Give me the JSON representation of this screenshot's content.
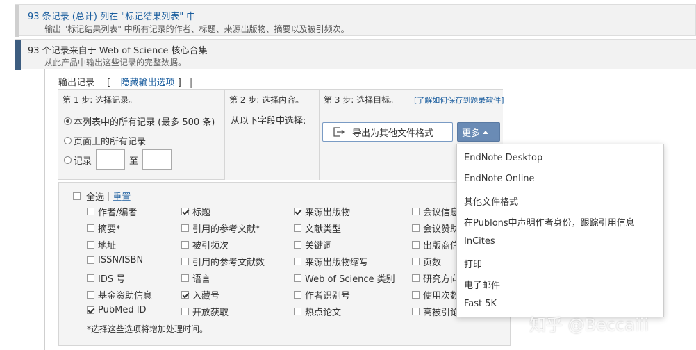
{
  "section1": {
    "title": "93 条记录 (总计) 列在 \"标记结果列表\" 中",
    "desc": "输出 \"标记结果列表\" 中所有记录的作者、标题、来源出版物、摘要以及被引频次。"
  },
  "section2": {
    "title": "93 个记录来自于 Web of Science 核心合集",
    "desc": "从此产品中输出这些记录的完整数据。"
  },
  "output": {
    "label": "输出记录",
    "bracket_open": "[",
    "minus": "–",
    "hide_link": "隐藏输出选项",
    "bracket_close": "]",
    "pipe": "|"
  },
  "step1": {
    "title": "第 1 步: 选择记录。",
    "opt_all_list": "本列表中的所有记录 (最多 500 条)",
    "opt_page": "页面上的所有记录",
    "opt_records": "记录",
    "to": "至",
    "selected": "opt_all_list"
  },
  "step2": {
    "title": "第 2 步: 选择内容。",
    "from_label": "从以下字段中选择:"
  },
  "step3": {
    "title": "第 3 步: 选择目标。",
    "help_link": "[了解如何保存到题录软件]",
    "export_label": "导出为其他文件格式",
    "more_label": "更多"
  },
  "fields": {
    "select_all": "全选",
    "separator": "|",
    "reset": "重置",
    "items": [
      {
        "label": "作者/编者",
        "checked": false
      },
      {
        "label": "标题",
        "checked": true
      },
      {
        "label": "来源出版物",
        "checked": true
      },
      {
        "label": "会议信息",
        "checked": false
      },
      {
        "label": "摘要*",
        "checked": false
      },
      {
        "label": "引用的参考文献*",
        "checked": false
      },
      {
        "label": "文献类型",
        "checked": false
      },
      {
        "label": "会议赞助",
        "checked": false
      },
      {
        "label": "地址",
        "checked": false
      },
      {
        "label": "被引频次",
        "checked": false
      },
      {
        "label": "关键词",
        "checked": false
      },
      {
        "label": "出版商信",
        "checked": false
      },
      {
        "label": "ISSN/ISBN",
        "checked": false
      },
      {
        "label": "引用的参考文献数",
        "checked": false
      },
      {
        "label": "来源出版物缩写",
        "checked": false
      },
      {
        "label": "页数",
        "checked": false
      },
      {
        "label": "IDS 号",
        "checked": false
      },
      {
        "label": "语言",
        "checked": false
      },
      {
        "label": "Web of Science 类别",
        "checked": false
      },
      {
        "label": "研究方向",
        "checked": false
      },
      {
        "label": "基金资助信息",
        "checked": false
      },
      {
        "label": "入藏号",
        "checked": true
      },
      {
        "label": "作者识别号",
        "checked": false
      },
      {
        "label": "使用次数",
        "checked": false
      },
      {
        "label": "PubMed ID",
        "checked": true
      },
      {
        "label": "开放获取",
        "checked": false
      },
      {
        "label": "热点论文",
        "checked": false
      },
      {
        "label": "高被引论",
        "checked": false
      }
    ],
    "note": "*选择这些选项将增加处理时间。"
  },
  "menu": {
    "items": [
      "EndNote Desktop",
      "EndNote Online",
      "其他文件格式",
      "在Publons中声明作者身份，跟踪引用信息",
      "InCites",
      "打印",
      "电子邮件",
      "Fast 5K"
    ]
  },
  "watermark": "知乎 @Beccaiii",
  "colors": {
    "link": "#1a5d9e",
    "accent_bar": "#3d5d80",
    "more_button": "#6a8bb5"
  }
}
